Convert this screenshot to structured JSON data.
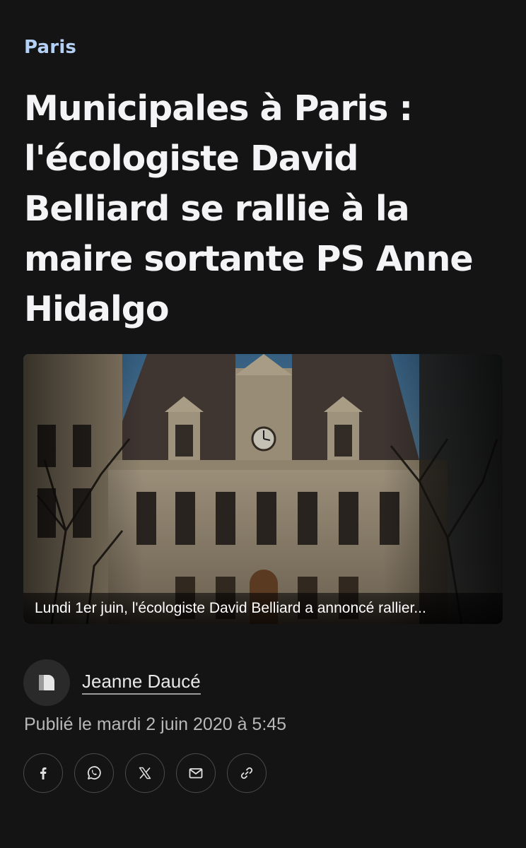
{
  "article": {
    "category": "Paris",
    "headline": "Municipales à Paris : l'écologiste David Belliard se rallie à la maire sortante PS Anne Hidalgo",
    "image": {
      "caption": "Lundi 1er juin, l'écologiste David Belliard a annoncé rallier..."
    },
    "author": {
      "name": "Jeanne Daucé",
      "avatar_icon": "author-logo-icon"
    },
    "published": "Publié le mardi 2 juin 2020 à 5:45"
  },
  "share": {
    "buttons": [
      {
        "icon": "facebook-icon"
      },
      {
        "icon": "whatsapp-icon"
      },
      {
        "icon": "x-icon"
      },
      {
        "icon": "email-icon"
      },
      {
        "icon": "link-icon"
      }
    ]
  },
  "colors": {
    "background": "#141414",
    "category": "#b4d0f5",
    "headline": "#f4f4f6",
    "meta": "#b8b8b8",
    "button_border": "#4a4a4a"
  }
}
